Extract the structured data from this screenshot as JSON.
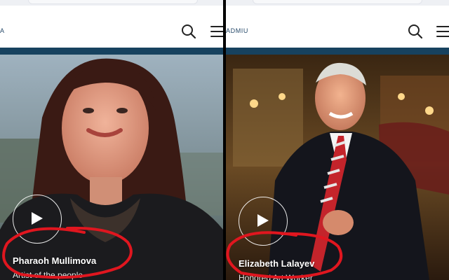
{
  "left_panel": {
    "logo_text": "A",
    "person_name": "Pharaoh Mullimova",
    "person_title": "Artist of the people",
    "icons": {
      "search": "search-icon",
      "menu": "hamburger-menu-icon",
      "play": "play-icon"
    }
  },
  "right_panel": {
    "logo_text": "ADMIU",
    "person_name": "Elizabeth Lalayev",
    "person_title": "Honored Art Worker",
    "icons": {
      "search": "search-icon",
      "menu": "hamburger-menu-icon",
      "play": "play-icon"
    }
  },
  "colors": {
    "nav_bar": "#17425f",
    "annotation_circle": "#e0161f",
    "divider": "#000000"
  }
}
